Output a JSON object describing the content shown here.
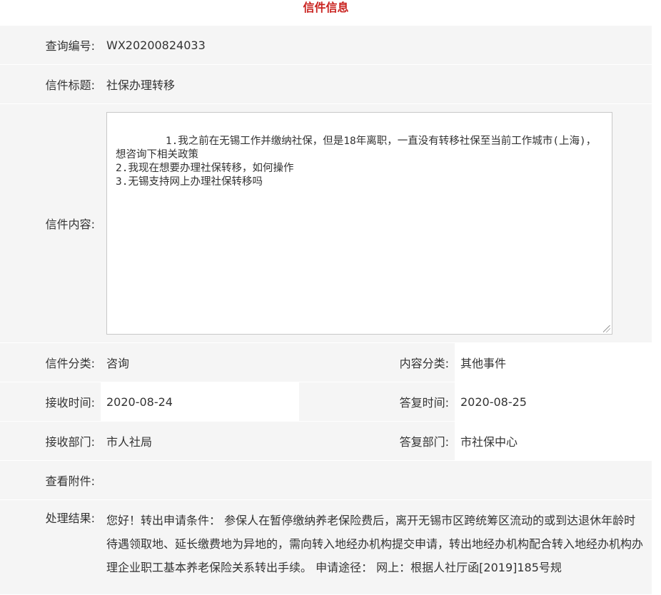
{
  "header": {
    "title": "信件信息"
  },
  "letter": {
    "query_no_label": "查询编号:",
    "query_no": "WX20200824033",
    "title_label": "信件标题:",
    "title": "社保办理转移",
    "content_label": "信件内容:",
    "content": "1.我之前在无锡工作并缴纳社保，但是18年离职，一直没有转移社保至当前工作城市(上海)，想咨询下相关政策\n2.我现在想要办理社保转移，如何操作\n3.无锡支持网上办理社保转移吗",
    "category_label": "信件分类:",
    "category": "咨询",
    "content_category_label": "内容分类:",
    "content_category": "其他事件",
    "receive_time_label": "接收时间:",
    "receive_time": "2020-08-24",
    "reply_time_label": "答复时间:",
    "reply_time": "2020-08-25",
    "receive_dept_label": "接收部门:",
    "receive_dept": "市人社局",
    "reply_dept_label": "答复部门:",
    "reply_dept": "市社保中心",
    "attachment_label": "查看附件:",
    "result_label": "处理结果:",
    "result": "您好！转出申请条件： 参保人在暂停缴纳养老保险费后，离开无锡市区跨统筹区流动的或到达退休年龄时待遇领取地、延长缴费地为异地的，需向转入地经办机构提交申请，转出地经办机构配合转入地经办机构办理企业职工基本养老保险关系转出手续。 申请途径： 网上：根据人社厅函[2019]185号规"
  }
}
